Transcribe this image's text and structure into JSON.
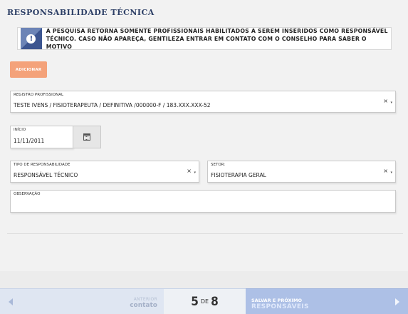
{
  "page": {
    "title": "RESPONSABILIDADE TÉCNICA"
  },
  "alert": {
    "icon": "exclamation-circle-icon",
    "line1": "A PESQUISA RETORNA SOMENTE PROFISSIONAIS HABILITADOS A SEREM INSERIDOS COMO RESPONSÁVEL",
    "line2": "TÉCNICO. CASO NÃO APAREÇA, GENTILEZA ENTRAR EM CONTATO COM O CONSELHO PARA SABER O MOTIVO"
  },
  "add_button": {
    "label": "ADICIONAR",
    "color": "#f4a27a"
  },
  "registro": {
    "label": "REGISTRO PROFISSIONAL",
    "value": "TESTE IVENS / FISIOTERAPEUTA / DEFINITIVA /000000-F / 183.XXX.XXX-52",
    "clear": "×",
    "caret": "▾"
  },
  "inicio": {
    "label": "INÍCIO",
    "value": "11/11/2011",
    "icon": "calendar-icon"
  },
  "tipo": {
    "label": "TIPO DE RESPONSABILIDADE",
    "value": "RESPONSÁVEL TÉCNICO",
    "clear": "×",
    "caret": "▾"
  },
  "setor": {
    "label": "SETOR:",
    "value": "FISIOTERAPIA GERAL",
    "clear": "×",
    "caret": "▾"
  },
  "observacao": {
    "label": "OBSERVAÇÃO",
    "value": ""
  },
  "footer": {
    "prev_top": "ANTERIOR",
    "prev_bottom": "contato",
    "step_current": "5",
    "step_of": "DE",
    "step_total": "8",
    "next_top": "SALVAR E PRÓXIMO",
    "next_bottom": "RESPONSÁVEIS",
    "accent": "#adc0e6"
  }
}
